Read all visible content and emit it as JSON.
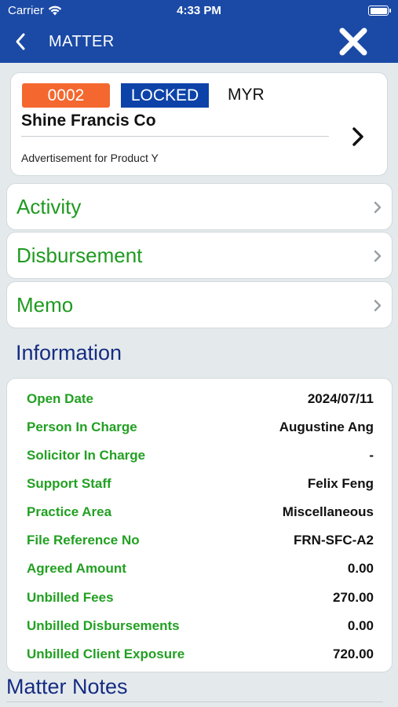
{
  "status_bar": {
    "carrier": "Carrier",
    "time": "4:33 PM",
    "battery_level": 1.0
  },
  "nav": {
    "title": "MATTER",
    "back_icon": "chevron-left-icon",
    "close_icon": "close-icon"
  },
  "matter": {
    "id": "0002",
    "status": "LOCKED",
    "currency": "MYR",
    "client": "Shine Francis Co",
    "description": "Advertisement for Product Y"
  },
  "menu": [
    {
      "label": "Activity"
    },
    {
      "label": "Disbursement"
    },
    {
      "label": "Memo"
    }
  ],
  "information": {
    "title": "Information",
    "rows": [
      {
        "key": "Open Date",
        "value": "2024/07/11"
      },
      {
        "key": "Person In Charge",
        "value": "Augustine Ang"
      },
      {
        "key": "Solicitor In Charge",
        "value": "-"
      },
      {
        "key": "Support Staff",
        "value": "Felix Feng"
      },
      {
        "key": "Practice Area",
        "value": "Miscellaneous"
      },
      {
        "key": "File Reference No",
        "value": "FRN-SFC-A2"
      },
      {
        "key": "Agreed Amount",
        "value": "0.00"
      },
      {
        "key": "Unbilled Fees",
        "value": "270.00"
      },
      {
        "key": "Unbilled Disbursements",
        "value": "0.00"
      },
      {
        "key": "Unbilled Client Exposure",
        "value": "720.00"
      }
    ]
  },
  "notes": {
    "title": "Matter Notes"
  },
  "colors": {
    "nav_bg": "#1b4aa6",
    "id_badge": "#f4682f",
    "status_badge": "#0d43a8",
    "menu_text": "#1f9a1f",
    "info_key": "#22a022",
    "section_title": "#162c82"
  }
}
